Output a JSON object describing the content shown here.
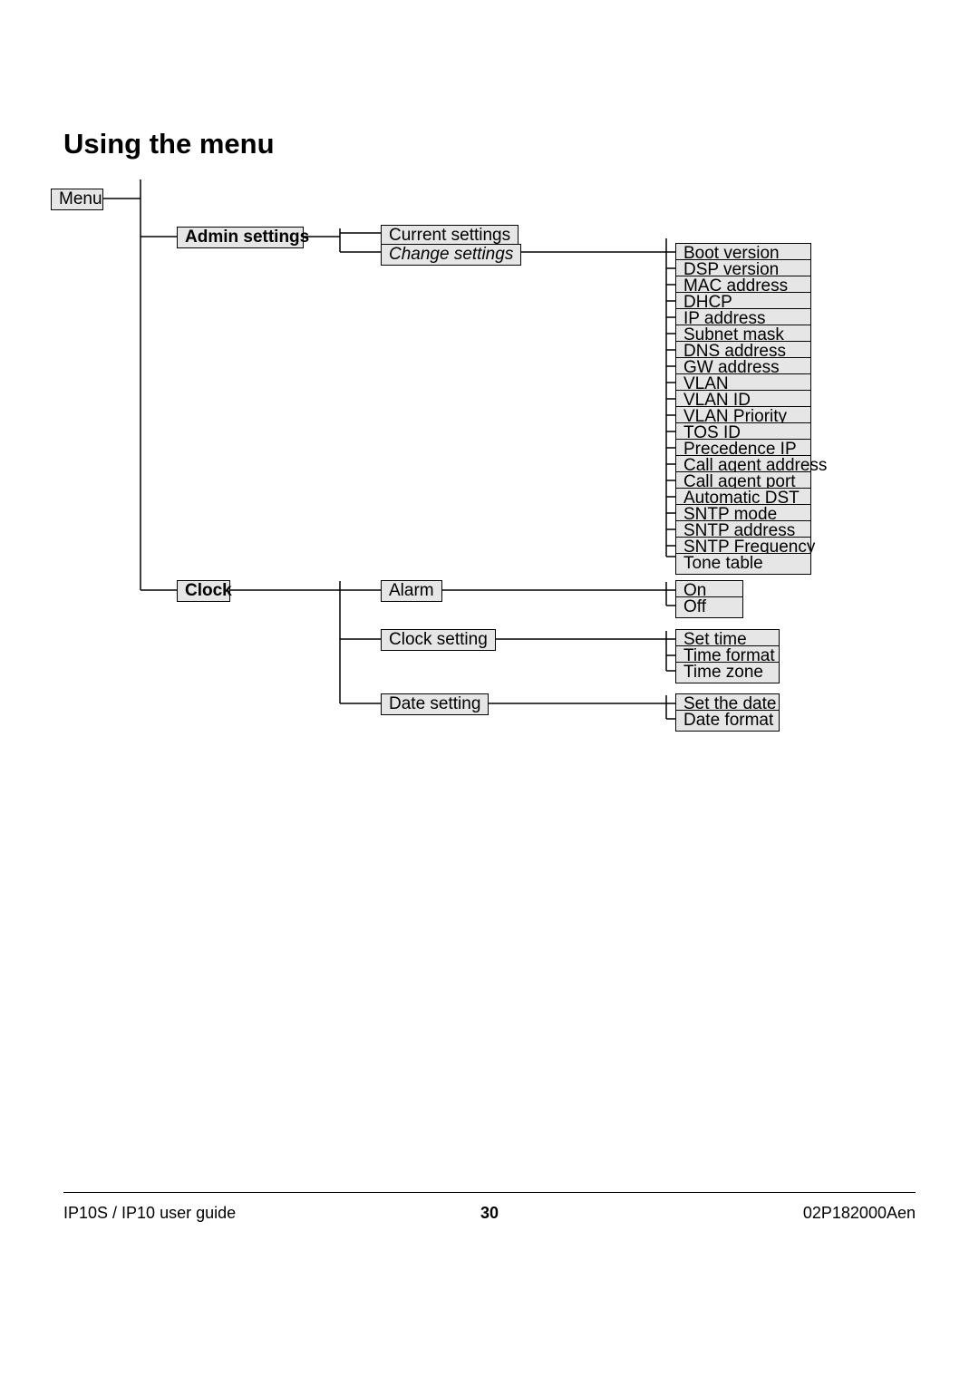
{
  "heading": "Using the menu",
  "menu_root": "Menu",
  "l1": {
    "admin": "Admin settings",
    "clock": "Clock"
  },
  "l2_admin": {
    "current": "Current settings",
    "change": "Change settings"
  },
  "l3_admin": [
    "Boot version",
    "DSP version",
    "MAC address",
    "DHCP",
    "IP address",
    "Subnet mask",
    "DNS address",
    "GW address",
    "VLAN",
    "VLAN ID",
    "VLAN Priority",
    "TOS ID",
    "Precedence IP",
    "Call agent address",
    "Call agent port",
    "Automatic DST",
    "SNTP mode",
    "SNTP address",
    "SNTP Frequency",
    "Tone table"
  ],
  "l2_clock": {
    "alarm": "Alarm",
    "clock_setting": "Clock setting",
    "date_setting": "Date setting"
  },
  "l3_alarm": [
    "On",
    "Off"
  ],
  "l3_clock": [
    "Set time",
    "Time format",
    "Time zone"
  ],
  "l3_date": [
    "Set the date",
    "Date format"
  ],
  "footer": {
    "left": "IP10S / IP10 user guide",
    "page": "30",
    "right": "02P182000Aen"
  }
}
